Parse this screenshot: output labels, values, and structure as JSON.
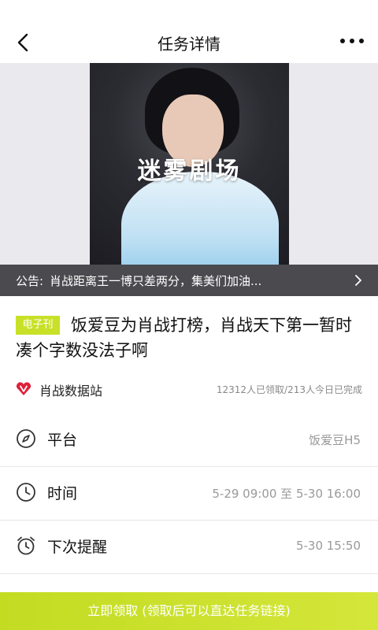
{
  "header": {
    "title": "任务详情",
    "back_icon": "chevron-left-icon",
    "more_icon": "more-horizontal-icon"
  },
  "banner": {
    "poster_text": "迷雾剧场"
  },
  "notice": {
    "label": "公告:",
    "text": "肖战距离王一博只差两分，集美们加油...",
    "arrow_icon": "chevron-right-icon"
  },
  "task": {
    "tag": "电子刊",
    "title": "饭爱豆为肖战打榜，肖战天下第一暂时凑个字数没法子啊"
  },
  "source": {
    "logo_icon": "heart-v-logo-icon",
    "name": "肖战数据站",
    "stats": "12312人已领取/213人今日已完成"
  },
  "details": [
    {
      "icon": "compass-icon",
      "label": "平台",
      "value": "饭爱豆H5"
    },
    {
      "icon": "clock-icon",
      "label": "时间",
      "value": "5-29 09:00 至 5-30 16:00"
    },
    {
      "icon": "alarm-clock-icon",
      "label": "下次提醒",
      "value": "5-30 15:50"
    }
  ],
  "cta": {
    "label": "立即领取 (领取后可以直达任务链接)"
  },
  "colors": {
    "accent": "#c8e028",
    "logo_red": "#e0203a"
  }
}
